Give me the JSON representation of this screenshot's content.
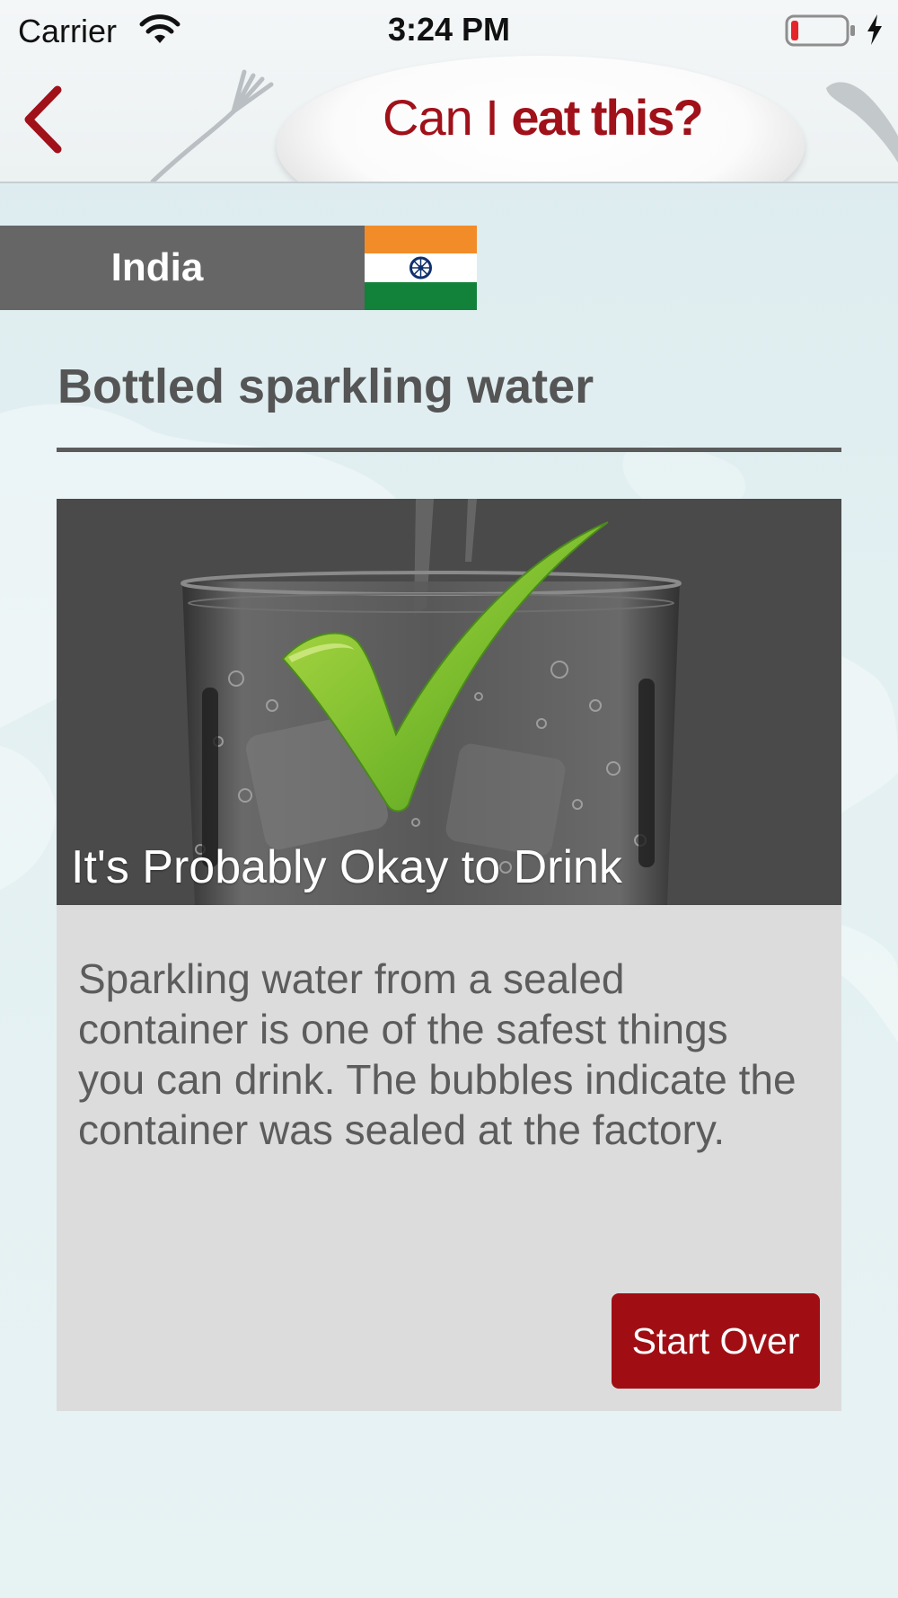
{
  "status_bar": {
    "carrier": "Carrier",
    "time": "3:24 PM",
    "wifi_icon": "wifi-icon",
    "battery_icon": "battery-low-icon",
    "charging_icon": "charging-bolt-icon"
  },
  "header": {
    "back_icon": "chevron-left-icon",
    "logo_light": "Can I ",
    "logo_bold": "eat this?",
    "logo_color": "#a0111a"
  },
  "country": {
    "name": "India",
    "flag_icon": "india-flag-icon",
    "flag_colors": [
      "#f28c28",
      "#ffffff",
      "#12813a",
      "#10306e"
    ]
  },
  "item": {
    "title": "Bottled sparkling water",
    "verdict": "It's Probably Okay to Drink",
    "verdict_icon": "green-checkmark-icon",
    "image": "sparkling-water-glass",
    "description": "Sparkling water from a sealed container is one of the safest things you can drink. The bubbles indicate the container was sealed at the factory."
  },
  "actions": {
    "start_over_label": "Start Over",
    "start_over_color": "#a00e14"
  }
}
